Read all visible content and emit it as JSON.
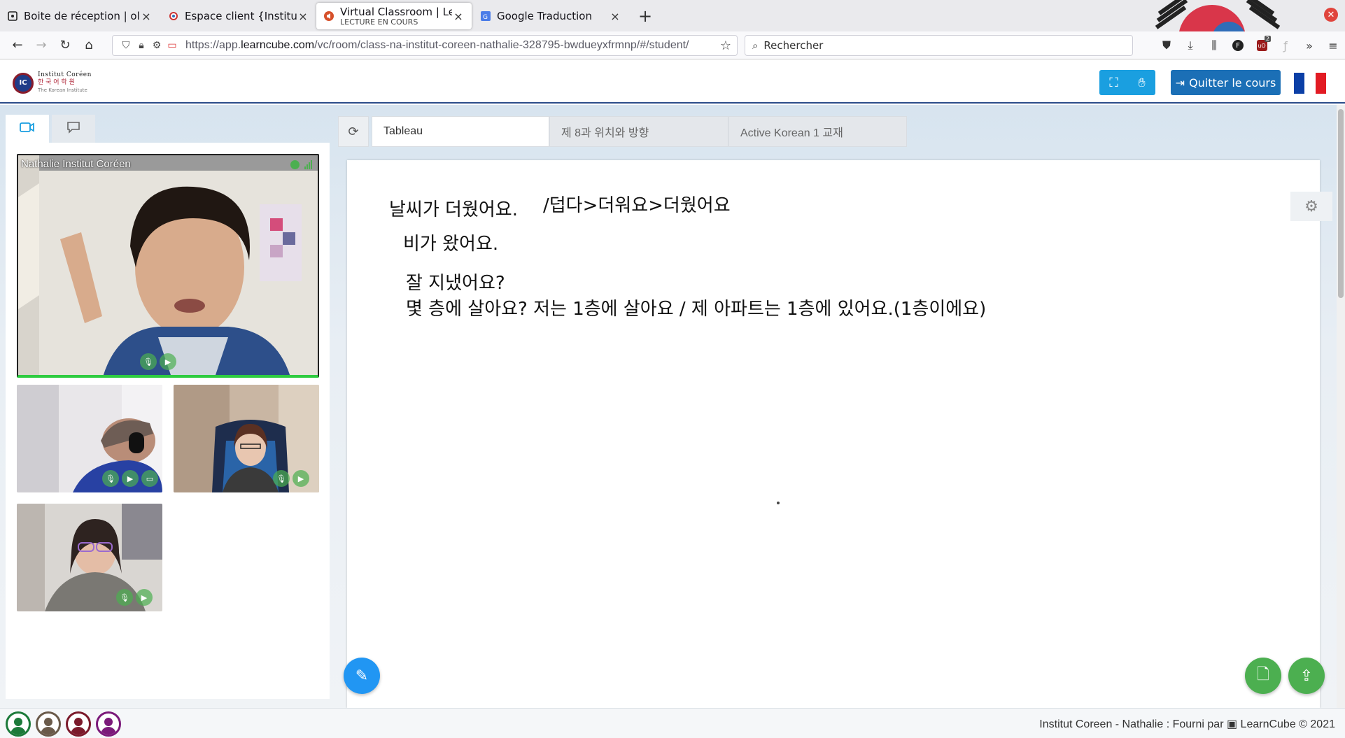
{
  "browser": {
    "tabs": [
      {
        "title": "Boite de réception | olivie",
        "icon": "mail-icon"
      },
      {
        "title": "Espace client {Institut Co",
        "icon": "target-icon"
      },
      {
        "title": "Virtual Classroom | Learn",
        "subtitle": "LECTURE EN COURS",
        "icon": "speaker-icon"
      },
      {
        "title": "Google Traduction",
        "icon": "translate-icon"
      }
    ],
    "url_prefix": "https://app.",
    "url_domain": "learncube.com",
    "url_path": "/vc/room/class-na-institut-coreen-nathalie-328795-bwdueyxfrmnp/#/student/",
    "search_placeholder": "Rechercher",
    "extension_badge": "2"
  },
  "header": {
    "logo_line1": "Institut Coréen",
    "logo_line2": "한 국 어 학 원",
    "logo_line3": "The Korean Institute",
    "quit_label": "Quitter le cours",
    "colors": {
      "accent": "#1a9fe0",
      "quit": "#1b6fb6",
      "flag": [
        "#0b3fa6",
        "#ffffff",
        "#e21b23"
      ]
    }
  },
  "videos": {
    "main_label": "Nathalie Institut Coréen"
  },
  "whiteboard": {
    "tabs": [
      "Tableau",
      "제 8과 위치와 방향",
      "Active Korean 1 교재"
    ],
    "lines": [
      "날씨가 더웠어요.",
      "/덥다>더워요>더웠어요",
      "비가 왔어요.",
      "잘 지냈어요?",
      "몇 층에 살아요? 저는  1층에 살아요 /  제 아파트는 1층에 있어요.(1층이에요)"
    ]
  },
  "footer": {
    "text": "Institut Coreen - Nathalie : Fourni par",
    "brand": "LearnCube © 2021",
    "avatar_colors": [
      "#1c7a3a",
      "#6a5a4a",
      "#7b1a2b",
      "#7b1a7a"
    ]
  }
}
